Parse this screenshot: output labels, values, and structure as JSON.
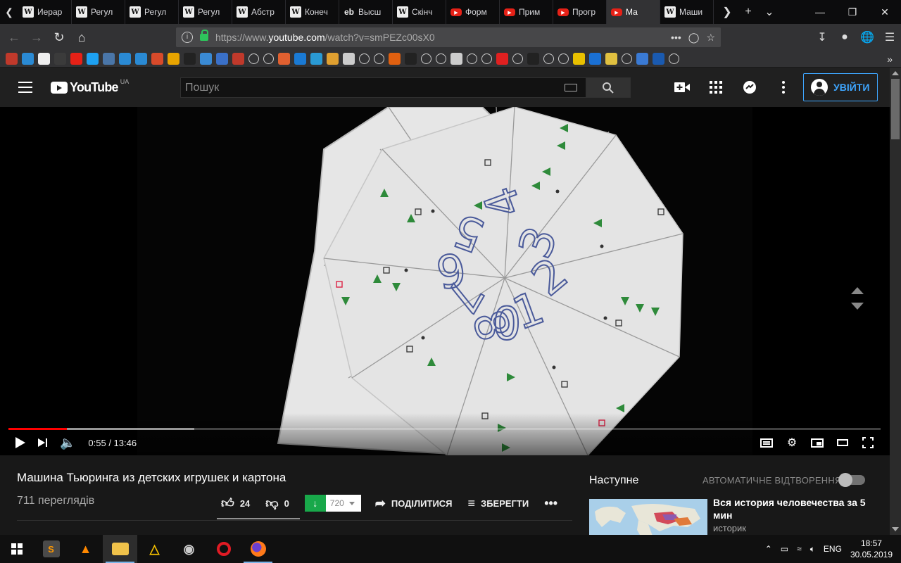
{
  "browser": {
    "tabs": [
      {
        "label": "Иерар",
        "favicon": "wikipedia-icon",
        "active": false
      },
      {
        "label": "Регул",
        "favicon": "wikipedia-icon",
        "active": false
      },
      {
        "label": "Регул",
        "favicon": "wikipedia-icon",
        "active": false
      },
      {
        "label": "Регул",
        "favicon": "wikipedia-icon",
        "active": false
      },
      {
        "label": "Абстр",
        "favicon": "wikipedia-icon",
        "active": false
      },
      {
        "label": "Конеч",
        "favicon": "wikipedia-icon",
        "active": false
      },
      {
        "label": "Высш",
        "favicon": "eb-icon",
        "active": false
      },
      {
        "label": "Скінч",
        "favicon": "wikipedia-icon",
        "active": false
      },
      {
        "label": "Форм",
        "favicon": "youtube-icon",
        "active": false
      },
      {
        "label": "Прим",
        "favicon": "youtube-icon",
        "active": false
      },
      {
        "label": "Прогр",
        "favicon": "youtube-icon",
        "active": false
      },
      {
        "label": "Ма",
        "favicon": "youtube-icon",
        "active": true
      },
      {
        "label": "Маши",
        "favicon": "wikipedia-icon",
        "active": false
      }
    ],
    "url_prefix": "https://www.",
    "url_domain": "youtube.com",
    "url_path": "/watch?v=smPEZc00sX0",
    "eb_favicon_text": "eb"
  },
  "youtube": {
    "logo_text": "YouTube",
    "country_code": "UA",
    "search_placeholder": "Пошук",
    "signin_label": "УВІЙТИ",
    "player": {
      "current_time": "0:55",
      "duration": "13:46",
      "time_display": "0:55 / 13:46",
      "played_fraction": 0.0666,
      "buffered_fraction": 0.213
    },
    "video": {
      "title": "Машина Тьюринга из детских игрушек и картона",
      "views": "711 переглядів",
      "likes": "24",
      "dislikes": "0",
      "download_quality": "720",
      "share_label": "ПОДІЛИТИСЯ",
      "save_label": "ЗБЕРЕГТИ"
    },
    "sidebar": {
      "up_next_label": "Наступне",
      "autoplay_label": "АВТОМАТИЧНЕ ВІДТВОРЕННЯ",
      "autoplay_on": false,
      "rec_title": "Вся история человечества за 5 мин",
      "rec_channel": "историк"
    },
    "wheel_digits": [
      "0",
      "1",
      "2",
      "3",
      "4",
      "5",
      "6",
      "7",
      "8"
    ]
  },
  "taskbar": {
    "language": "ENG",
    "time": "18:57",
    "date": "30.05.2019"
  },
  "colors": {
    "yt_red": "#ff0000",
    "signin_blue": "#3ea6ff",
    "download_green": "#18a84a"
  }
}
